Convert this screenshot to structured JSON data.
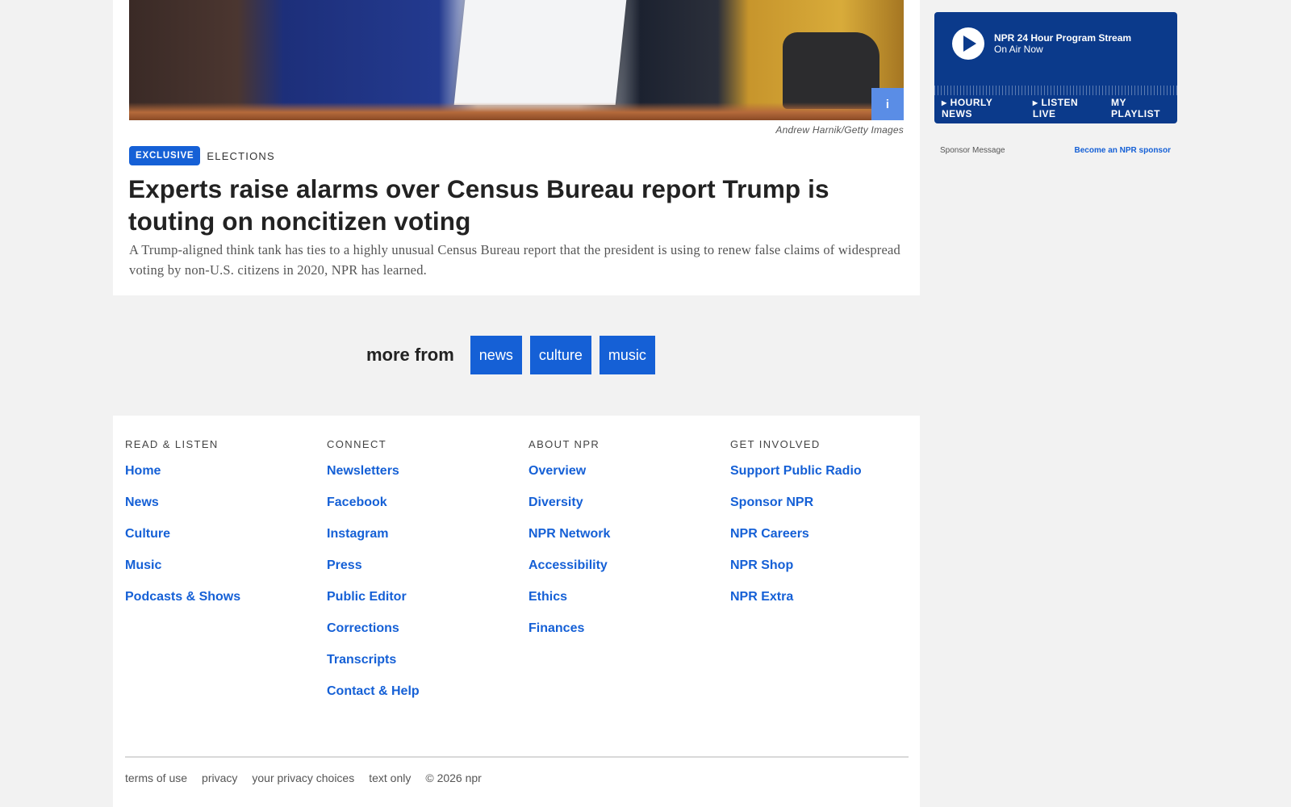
{
  "article": {
    "photo_credit": "Andrew Harnik/Getty Images",
    "info_button": "i",
    "badge": "EXCLUSIVE",
    "section": "ELECTIONS",
    "headline": "Experts raise alarms over Census Bureau report Trump is touting on noncitizen voting",
    "teaser": "A Trump-aligned think tank has ties to a highly unusual Census Bureau report that the president is using to renew false claims of widespread voting by non-U.S. citizens in 2020, NPR has learned."
  },
  "more_from": {
    "label": "more from",
    "links": [
      "news",
      "culture",
      "music"
    ]
  },
  "player": {
    "stream_title": "NPR 24 Hour Program Stream",
    "status": "On Air Now",
    "nav": {
      "hourly_news": "HOURLY NEWS",
      "listen_live": "LISTEN LIVE",
      "my_playlist": "MY PLAYLIST"
    },
    "accent_color": "#0b3a8b"
  },
  "sponsor": {
    "message": "Sponsor Message",
    "link": "Become an NPR sponsor"
  },
  "footer": {
    "columns": [
      {
        "heading": "READ & LISTEN",
        "links": [
          "Home",
          "News",
          "Culture",
          "Music",
          "Podcasts & Shows"
        ]
      },
      {
        "heading": "CONNECT",
        "links": [
          "Newsletters",
          "Facebook",
          "Instagram",
          "Press",
          "Public Editor",
          "Corrections",
          "Transcripts",
          "Contact & Help"
        ]
      },
      {
        "heading": "ABOUT NPR",
        "links": [
          "Overview",
          "Diversity",
          "NPR Network",
          "Accessibility",
          "Ethics",
          "Finances"
        ]
      },
      {
        "heading": "GET INVOLVED",
        "links": [
          "Support Public Radio",
          "Sponsor NPR",
          "NPR Careers",
          "NPR Shop",
          "NPR Extra"
        ]
      }
    ],
    "legal": [
      "terms of use",
      "privacy",
      "your privacy choices",
      "text only",
      "© 2026 npr"
    ]
  },
  "colors": {
    "link_blue": "#1560d6",
    "background": "#f2f2f2"
  }
}
